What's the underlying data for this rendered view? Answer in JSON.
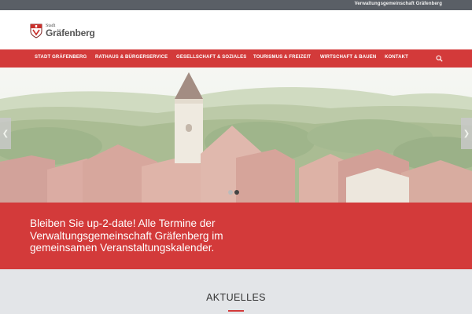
{
  "topbar": {
    "text": "Verwaltungsgemeinschaft Gräfenberg"
  },
  "logo": {
    "small": "Stadt",
    "big": "Gräfenberg"
  },
  "nav": {
    "items": [
      "STADT GRÄFENBERG",
      "RATHAUS & BÜRGERSERVICE",
      "GESELLSCHAFT & SOZIALES",
      "TOURISMUS & FREIZEIT",
      "WIRTSCHAFT & BAUEN",
      "KONTAKT"
    ],
    "search_icon": "search-icon"
  },
  "slider": {
    "prev_icon": "chevron-left-icon",
    "next_icon": "chevron-right-icon",
    "slides": 2,
    "active_slide": 2
  },
  "banner": {
    "text": "Bleiben Sie up-2-date! Alle Termine der Verwaltungsgemeinschaft Gräfenberg im gemeinsamen Veranstaltungskalender."
  },
  "news": {
    "title": "AKTUELLES"
  },
  "colors": {
    "accent": "#d33a3a",
    "topbar": "#5a5f66",
    "section_bg": "#e3e5e8"
  }
}
